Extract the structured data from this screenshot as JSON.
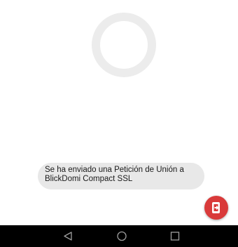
{
  "toast": {
    "message": "Se ha enviado una Petición de Unión a BlickDomi Compact SSL"
  },
  "icons": {
    "loading": "loading-spinner-icon",
    "fab": "exit-door-icon",
    "back": "back-triangle-icon",
    "home": "home-circle-icon",
    "recents": "recents-square-icon"
  },
  "colors": {
    "spinner": "#ececec",
    "toast_bg": "#e8e8e8",
    "fab_bg": "#d93a3a",
    "navbar_bg": "#000000",
    "nav_icons": "#9e9e9e"
  }
}
